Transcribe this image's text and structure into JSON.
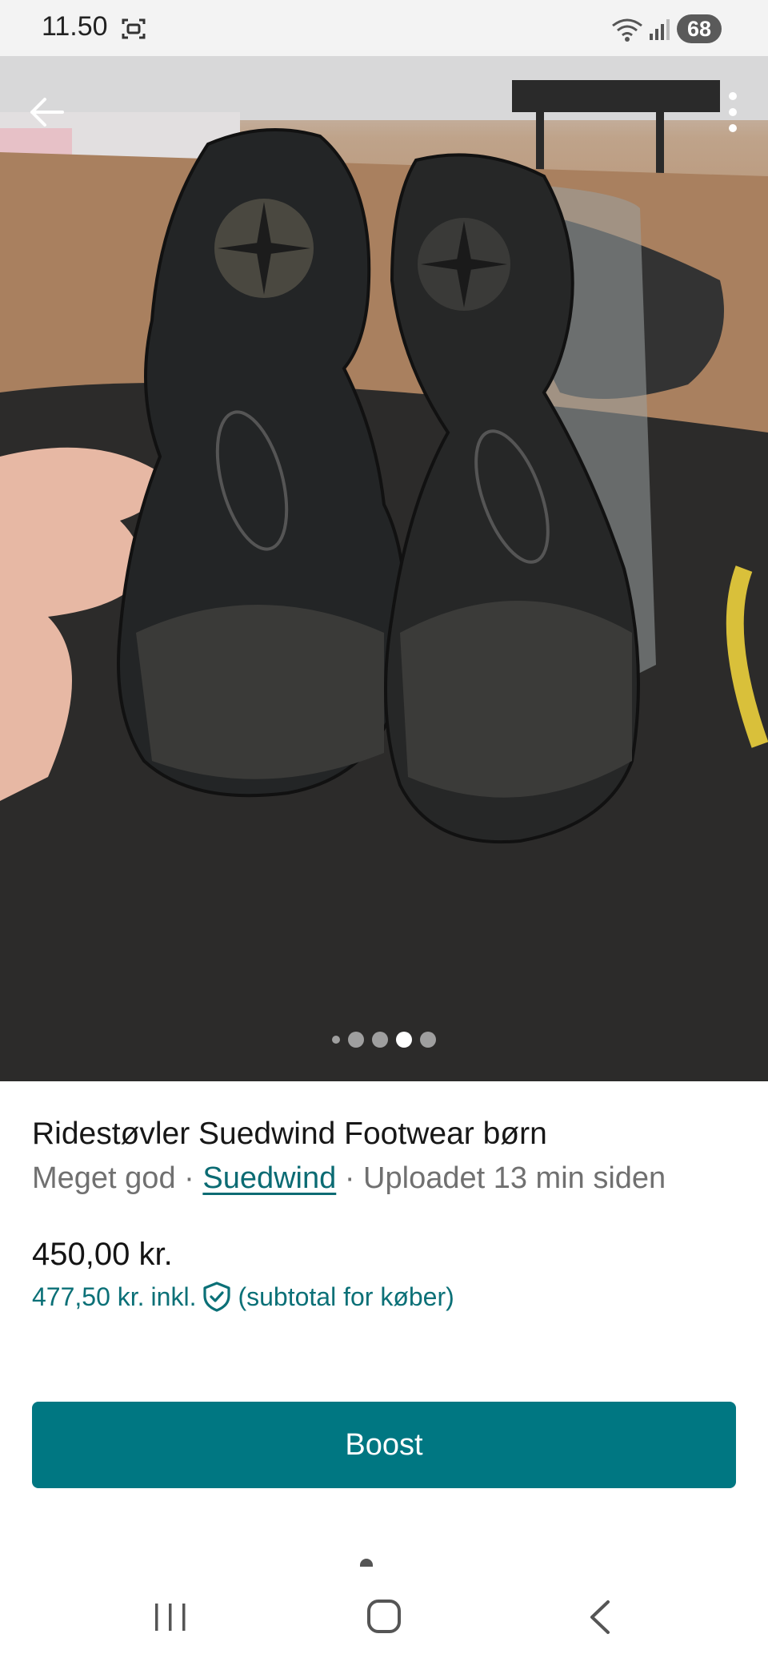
{
  "status_bar": {
    "time": "11.50",
    "battery": "68"
  },
  "gallery": {
    "image_count": 5,
    "active_index": 3
  },
  "listing": {
    "title": "Ridestøvler Suedwind Footwear børn",
    "condition": "Meget god",
    "separator": " · ",
    "brand": "Suedwind",
    "uploaded": "Uploadet 13 min siden",
    "price": "450,00 kr.",
    "buyer_price": "477,50 kr.",
    "buyer_price_incl": "inkl.",
    "buyer_price_note": "(subtotal for køber)"
  },
  "actions": {
    "boost_label": "Boost"
  },
  "colors": {
    "accent": "#007782",
    "link": "#0b6b73"
  },
  "icons": {
    "back": "arrow-left-icon",
    "more": "more-vertical-icon",
    "buyer_protection": "shield-check-icon"
  }
}
